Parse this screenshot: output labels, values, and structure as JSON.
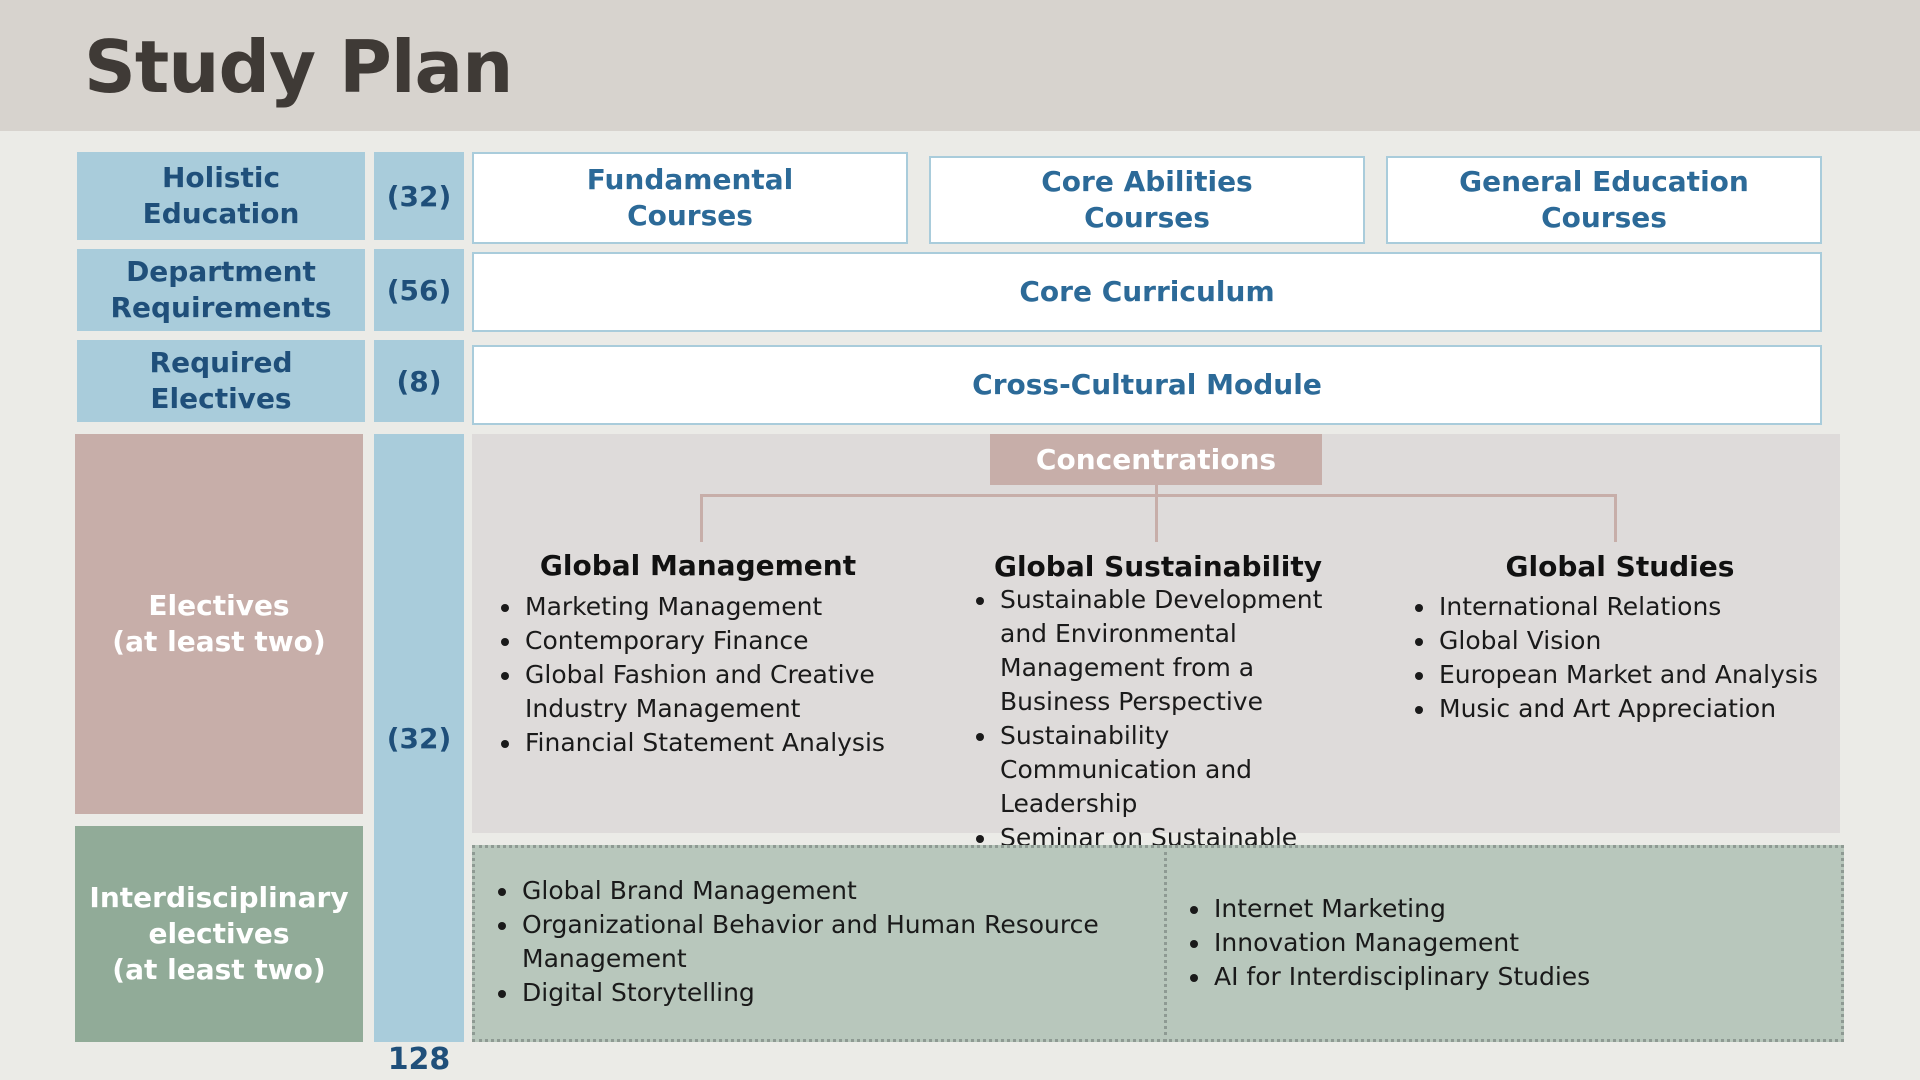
{
  "title": "Study Plan",
  "categories": [
    {
      "label": "Holistic\nEducation",
      "credits": "(32)"
    },
    {
      "label": "Department\nRequirements",
      "credits": "(56)"
    },
    {
      "label": "Required\nElectives",
      "credits": "(8)"
    },
    {
      "label": "Electives\n(at least two)"
    },
    {
      "label": "Interdisciplinary\nelectives\n(at least two)"
    }
  ],
  "electives_credits": "(32)",
  "holistic_boxes": [
    "Fundamental\nCourses",
    "Core Abilities\nCourses",
    "General Education\nCourses"
  ],
  "core_curriculum": "Core Curriculum",
  "cross_cultural": "Cross-Cultural Module",
  "concentrations_label": "Concentrations",
  "concentrations": [
    {
      "name": "Global Management",
      "courses": [
        "Marketing Management",
        "Contemporary Finance",
        "Global Fashion and Creative Industry Management",
        "Financial Statement Analysis"
      ]
    },
    {
      "name": "Global Sustainability",
      "courses": [
        "Sustainable Development and Environmental Management from a Business Perspective",
        "Sustainability Communication and Leadership",
        "Seminar on Sustainable Development"
      ]
    },
    {
      "name": "Global Studies",
      "courses": [
        "International Relations",
        "Global Vision",
        "European Market and Analysis",
        "Music and Art Appreciation"
      ]
    }
  ],
  "interdisciplinary_left": [
    "Global Brand Management",
    "Organizational Behavior and Human Resource Management",
    "Digital Storytelling"
  ],
  "interdisciplinary_right": [
    "Internet Marketing",
    "Innovation Management",
    "AI for Interdisciplinary Studies"
  ],
  "total_credits": "128",
  "colors": {
    "header_bg": "#d7d3ce",
    "page_bg": "#ebebe7",
    "blue_block": "#a9ccdb",
    "navy_text": "#1f4f7a",
    "rose": "#c7aea9",
    "sage": "#91ab98",
    "concentration_panel": "#dedbda",
    "interdisciplinary_panel": "#b8c7bc"
  }
}
